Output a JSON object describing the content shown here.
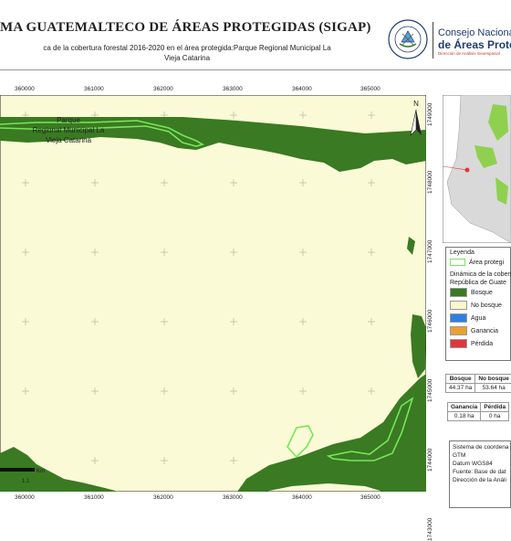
{
  "header": {
    "title": "MA GUATEMALTECO DE ÁREAS PROTEGIDAS  (SIGAP)",
    "subtitle_line1": "ca de la cobertura forestal 2016-2020 en el área protegida:Parque Regional Municipal La",
    "subtitle_line2": "Vieja Catarina",
    "seal_text": "GOBIERNO DE LA REPÚBLICA · GUATEMALA",
    "org_line1": "Consejo Nacional",
    "org_line2": "de Áreas Protegi",
    "org_line3": "Dirección de Análisis Geoespacial"
  },
  "map": {
    "x_ticks": [
      "360000",
      "361000",
      "362000",
      "363000",
      "364000",
      "365000"
    ],
    "y_ticks": [
      "1749000",
      "1748000",
      "1747000",
      "1746000",
      "1745000",
      "1744000",
      "1743000"
    ],
    "area_label_line1": "Parque",
    "area_label_line2": "Regional Municipal La",
    "area_label_line3": "Vieja Catarina",
    "north_label": "N",
    "scale_unit": "Km",
    "scale_value": "1.1",
    "colors": {
      "background": "#fbfad7",
      "forest": "#3a7a22",
      "boundary": "#77e65a",
      "grid": "#b9b7a0"
    }
  },
  "legend": {
    "title": "Leyenda",
    "items": [
      {
        "label": "Área protegi",
        "color": "#77e65a",
        "kind": "outline"
      },
      {
        "label": "Dinámica de la cobertu",
        "color": "",
        "kind": "text"
      },
      {
        "label": "República de Guate",
        "color": "",
        "kind": "text"
      },
      {
        "label": "Bosque",
        "color": "#3a7a22",
        "kind": "fill"
      },
      {
        "label": "No bosque",
        "color": "#fbf8d0",
        "kind": "fill"
      },
      {
        "label": "Agua",
        "color": "#2f7fe0",
        "kind": "fill"
      },
      {
        "label": "Ganancia",
        "color": "#eaa032",
        "kind": "fill"
      },
      {
        "label": "Pérdida",
        "color": "#e0373b",
        "kind": "fill"
      }
    ]
  },
  "stats_table1": {
    "headers": [
      "Bosque",
      "No bosque"
    ],
    "values": [
      "44.37 ha",
      "53.64 ha"
    ]
  },
  "stats_table2": {
    "headers": [
      "Ganancia",
      "Pérdida"
    ],
    "values": [
      "0.18 ha",
      "0 ha"
    ]
  },
  "info": {
    "lines": [
      "Sistema de coordena",
      "GTM",
      "Datum WGS84",
      "Fuente: Base de dat",
      "Dirección de la Análi"
    ]
  }
}
